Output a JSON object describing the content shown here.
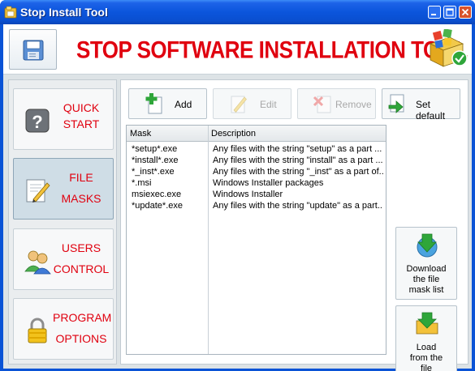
{
  "window": {
    "title": "Stop Install Tool"
  },
  "header": {
    "banner": "STOP SOFTWARE INSTALLATION TOOL"
  },
  "sidebar": {
    "items": [
      {
        "line1": "QUICK",
        "line2": "START",
        "icon": "help-icon"
      },
      {
        "line1": "FILE",
        "line2": "MASKS",
        "icon": "edit-icon"
      },
      {
        "line1": "USERS",
        "line2": "CONTROL",
        "icon": "users-icon"
      },
      {
        "line1": "PROGRAM",
        "line2": "OPTIONS",
        "icon": "lock-icon"
      }
    ],
    "active_index": 1
  },
  "toolbar": {
    "add_label": "Add",
    "edit_label": "Edit",
    "remove_label": "Remove",
    "set_default_label": "Set default"
  },
  "table": {
    "columns": [
      "Mask",
      "Description"
    ],
    "rows": [
      {
        "mask": "*setup*.exe",
        "description": "Any files with the string \"setup\" as a part ..."
      },
      {
        "mask": "*install*.exe",
        "description": "Any files with the string \"install\" as a part ..."
      },
      {
        "mask": "*_inst*.exe",
        "description": "Any files with the string \"_inst\" as a part of..."
      },
      {
        "mask": "*.msi",
        "description": "Windows Installer packages"
      },
      {
        "mask": "msiexec.exe",
        "description": "Windows Installer"
      },
      {
        "mask": "*update*.exe",
        "description": "Any files with the string \"update\" as a part..."
      }
    ]
  },
  "side_buttons": {
    "download": {
      "line1": "Download",
      "line2": "the file",
      "line3": "mask list"
    },
    "load": {
      "line1": "Load",
      "line2": "from the",
      "line3": "file"
    }
  },
  "colors": {
    "accent_red": "#e0000f",
    "titlebar_blue": "#0a55dc",
    "panel_gray": "#dde3e6"
  }
}
